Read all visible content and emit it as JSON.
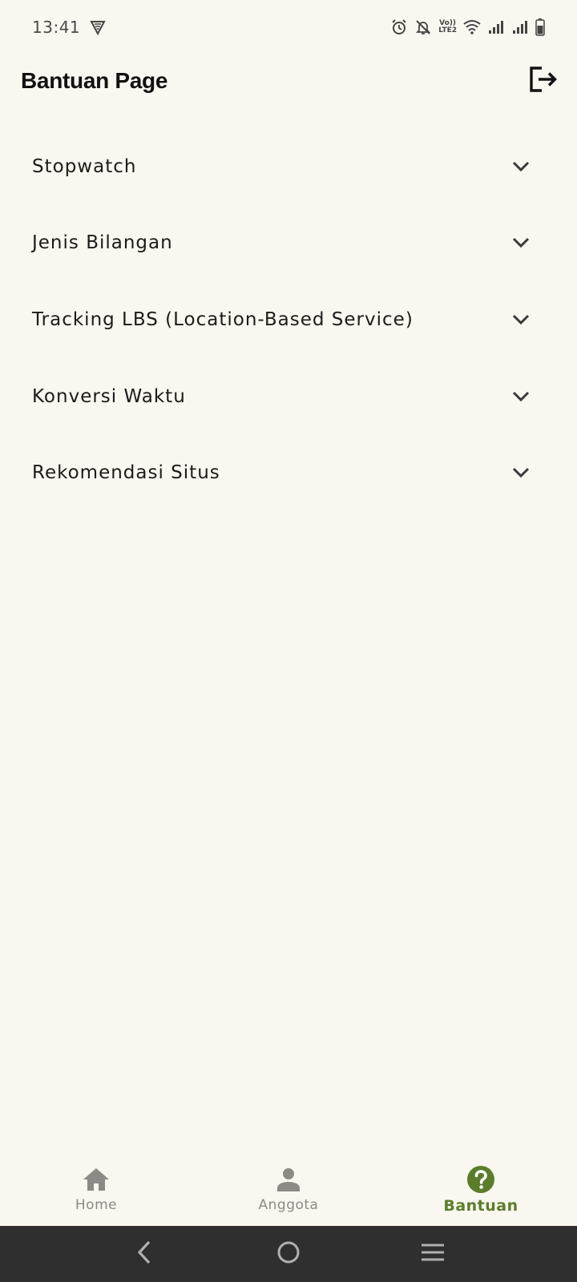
{
  "status_bar": {
    "time": "13:41",
    "left_icons": [
      "vpn-shield-icon"
    ],
    "right_icons": [
      "alarm-icon",
      "bell-off-icon",
      "volte-icon",
      "wifi-icon",
      "signal-icon",
      "signal-icon",
      "battery-icon"
    ],
    "volte_text_top": "Vo))",
    "volte_text_bottom": "LTE2"
  },
  "app_bar": {
    "title": "Bantuan Page",
    "logout_icon": "logout-icon"
  },
  "help_items": [
    {
      "label": "Stopwatch",
      "icon": "chevron-down-icon"
    },
    {
      "label": "Jenis Bilangan",
      "icon": "chevron-down-icon"
    },
    {
      "label": "Tracking LBS (Location-Based Service)",
      "icon": "chevron-down-icon"
    },
    {
      "label": "Konversi Waktu",
      "icon": "chevron-down-icon"
    },
    {
      "label": "Rekomendasi Situs",
      "icon": "chevron-down-icon"
    }
  ],
  "bottom_nav": {
    "items": [
      {
        "label": "Home",
        "icon": "home-icon",
        "active": false
      },
      {
        "label": "Anggota",
        "icon": "person-icon",
        "active": false
      },
      {
        "label": "Bantuan",
        "icon": "help-circle-icon",
        "active": true
      }
    ]
  },
  "system_nav": {
    "buttons": [
      "back-icon",
      "home-circle-icon",
      "menu-icon"
    ]
  },
  "colors": {
    "background": "#faf6f0",
    "accent": "#5a7d2b",
    "inactive": "#8c8a86",
    "system_bar": "#2f2f2f"
  }
}
